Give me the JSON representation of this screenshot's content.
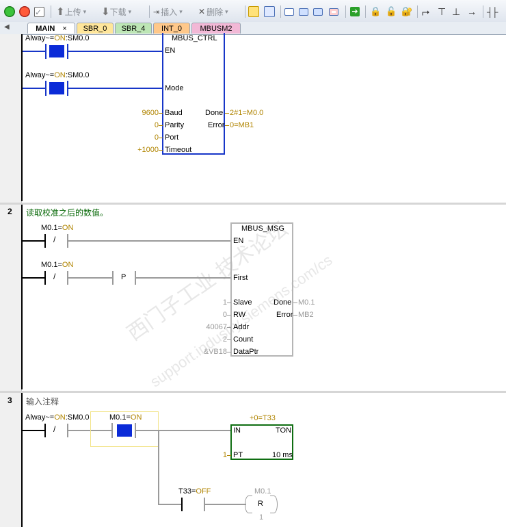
{
  "toolbar": {
    "upload_label": "上传",
    "download_label": "下载",
    "insert_label": "插入",
    "delete_label": "删除"
  },
  "tabs": [
    {
      "label": "MAIN",
      "close": "×"
    },
    {
      "label": "SBR_0"
    },
    {
      "label": "SBR_4"
    },
    {
      "label": "INT_0"
    },
    {
      "label": "MBUSM2"
    }
  ],
  "colors": {
    "blue_contact": "#0b2bd8",
    "box_blue": "#1736c8",
    "ton_green": "#0f6e12",
    "comment_green": "#0a6a0a",
    "on_text": "#b08400"
  },
  "network1": {
    "contact1": {
      "pre": "Alway~=",
      "state": "ON",
      "post": ":SM0.0"
    },
    "contact2": {
      "pre": "Alway~=",
      "state": "ON",
      "post": ":SM0.0"
    },
    "block": {
      "title": "MBUS_CTRL",
      "inputs": [
        "EN",
        "Mode",
        "Baud",
        "Parity",
        "Port",
        "Timeout"
      ],
      "input_values": {
        "baud": "9600",
        "parity": "0",
        "port": "0",
        "timeout": "+1000"
      },
      "outputs": [
        "Done",
        "Error"
      ],
      "output_values": {
        "done": "2#1=M0.0",
        "error": "0=MB1"
      }
    }
  },
  "network2": {
    "number": "2",
    "comment": "读取校准之后的数值。",
    "contact1": {
      "pre": "M0.1=",
      "state": "ON",
      "symbol": "/"
    },
    "contact2": {
      "pre": "M0.1=",
      "state": "ON",
      "symbol": "/"
    },
    "p_contact": "P",
    "block": {
      "title": "MBUS_MSG",
      "inputs": [
        "EN",
        "First",
        "Slave",
        "RW",
        "Addr",
        "Count",
        "DataPtr"
      ],
      "input_values": {
        "slave": "1",
        "rw": "0",
        "addr": "40067",
        "count": "2",
        "dataptr": "&VB18"
      },
      "outputs": [
        "Done",
        "Error"
      ],
      "output_values": {
        "done": "M0.1",
        "error": "MB2"
      }
    }
  },
  "network3": {
    "number": "3",
    "comment": "输入注释",
    "contact1": {
      "pre": "Alway~=",
      "state": "ON",
      "post": ":SM0.0",
      "symbol": "/"
    },
    "contact2": {
      "pre": "M0.1=",
      "state": "ON"
    },
    "timer": {
      "value": "+0=T33",
      "in": "IN",
      "type": "TON",
      "pt": "PT",
      "pt_value": "1",
      "unit": "10 ms"
    },
    "contact3": {
      "pre": "T33=",
      "state": "OFF"
    },
    "coil": {
      "address": "M0.1",
      "type": "R",
      "count": "1"
    }
  },
  "watermark": {
    "line1": "西门子工业  技术论坛",
    "line2": "support.industry.siemens.com/cs"
  }
}
